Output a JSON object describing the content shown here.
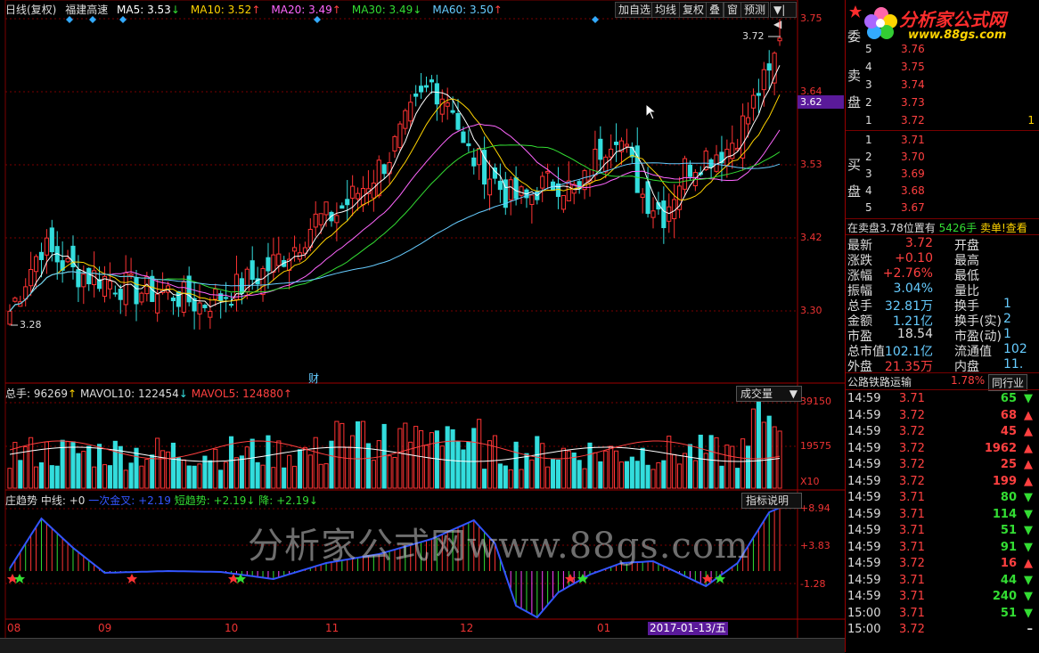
{
  "toolbar": {
    "period": "日线(复权)",
    "stock_name": "福建高速",
    "ma": [
      {
        "label": "MA5: 3.53",
        "arrow": "↓",
        "color": "#ffffff"
      },
      {
        "label": "MA10: 3.52",
        "arrow": "↑",
        "color": "#ffd400"
      },
      {
        "label": "MA20: 3.49",
        "arrow": "↑",
        "color": "#ff66ff"
      },
      {
        "label": "MA30: 3.49",
        "arrow": "↓",
        "color": "#33dd33"
      },
      {
        "label": "MA60: 3.50",
        "arrow": "↑",
        "color": "#66ccff"
      }
    ],
    "buttons": [
      "加自选",
      "均线",
      "复权",
      "叠",
      "窗",
      "预测"
    ],
    "more": "▼|◀"
  },
  "price_axis": [
    "3.75",
    "3.64",
    "3.53",
    "3.42",
    "3.30"
  ],
  "current_price": "3.62",
  "annot_high": "3.72",
  "annot_low": "3.28",
  "fin_mark": "财",
  "volume_panel": {
    "label_total": "总手: 96269",
    "label_total_arrow": "↑",
    "label_mavol10": "MAVOL10: 122454",
    "label_mavol10_arrow": "↓",
    "label_mavol5": "MAVOL5: 124880",
    "label_mavol5_arrow": "↑",
    "dropdown": "成交量",
    "axis": [
      "39150",
      "19575",
      "X10"
    ]
  },
  "indicator_panel": {
    "name": "庄趋势",
    "mid": "中线: +0",
    "once": "一次金叉: +2.19",
    "short": "短趋势: +2.19",
    "down": "降: +2.19",
    "button": "指标说明",
    "axis": [
      "+8.94",
      "+3.83",
      "-1.28"
    ]
  },
  "x_axis": [
    {
      "label": "08"
    },
    {
      "label": "09"
    },
    {
      "label": "10"
    },
    {
      "label": "11"
    },
    {
      "label": "12"
    },
    {
      "label": "01"
    }
  ],
  "cursor_date": "2017-01-13/五",
  "watermark": "分析家公式网www.88gs.com",
  "right": {
    "logo_text": "分析家公式网",
    "logo_url": "www.88gs.com",
    "committee": "委",
    "sell_chars": "卖盘",
    "buy_chars": "买盘",
    "sell": [
      {
        "lvl": "5",
        "price": "3.76",
        "vol": ""
      },
      {
        "lvl": "4",
        "price": "3.75",
        "vol": ""
      },
      {
        "lvl": "3",
        "price": "3.74",
        "vol": ""
      },
      {
        "lvl": "2",
        "price": "3.73",
        "vol": ""
      },
      {
        "lvl": "1",
        "price": "3.72",
        "vol": "1"
      }
    ],
    "buy": [
      {
        "lvl": "1",
        "price": "3.71",
        "vol": ""
      },
      {
        "lvl": "2",
        "price": "3.70",
        "vol": ""
      },
      {
        "lvl": "3",
        "price": "3.69",
        "vol": ""
      },
      {
        "lvl": "4",
        "price": "3.68",
        "vol": ""
      },
      {
        "lvl": "5",
        "price": "3.67",
        "vol": ""
      }
    ],
    "notice_left": "在卖盘3.78位置有",
    "notice_mid": "5426手",
    "notice_right": "卖单!查看",
    "stats": [
      {
        "l": "最新",
        "v": "3.72",
        "vc": "#ff4040",
        "l2": "开盘",
        "v2": ""
      },
      {
        "l": "涨跌",
        "v": "+0.10",
        "vc": "#ff4040",
        "l2": "最高",
        "v2": ""
      },
      {
        "l": "涨幅",
        "v": "+2.76%",
        "vc": "#ff4040",
        "l2": "最低",
        "v2": ""
      },
      {
        "l": "振幅",
        "v": "3.04%",
        "vc": "#66ccff",
        "l2": "量比",
        "v2": ""
      },
      {
        "l": "总手",
        "v": "32.81万",
        "vc": "#66ccff",
        "l2": "换手",
        "v2": "1"
      },
      {
        "l": "金额",
        "v": "1.21亿",
        "vc": "#66ccff",
        "l2": "换手(实)",
        "v2": "2"
      },
      {
        "l": "市盈",
        "v": "18.54",
        "vc": "#dddddd",
        "l2": "市盈(动)",
        "v2": "1"
      },
      {
        "l": "总市值",
        "v": "102.1亿",
        "vc": "#66ccff",
        "l2": "流通值",
        "v2": "102"
      },
      {
        "l": "外盘",
        "v": "21.35万",
        "vc": "#ff4040",
        "l2": "内盘",
        "v2": "11."
      }
    ],
    "industry": "公路铁路运输",
    "industry_pct": "1.78%",
    "industry_btn": "同行业",
    "ticks": [
      {
        "t": "14:59",
        "p": "3.71",
        "v": "65",
        "d": "down"
      },
      {
        "t": "14:59",
        "p": "3.72",
        "v": "68",
        "d": "up"
      },
      {
        "t": "14:59",
        "p": "3.72",
        "v": "45",
        "d": "up"
      },
      {
        "t": "14:59",
        "p": "3.72",
        "v": "1962",
        "d": "up"
      },
      {
        "t": "14:59",
        "p": "3.72",
        "v": "25",
        "d": "up"
      },
      {
        "t": "14:59",
        "p": "3.72",
        "v": "199",
        "d": "up"
      },
      {
        "t": "14:59",
        "p": "3.71",
        "v": "80",
        "d": "down"
      },
      {
        "t": "14:59",
        "p": "3.71",
        "v": "114",
        "d": "down"
      },
      {
        "t": "14:59",
        "p": "3.71",
        "v": "51",
        "d": "down"
      },
      {
        "t": "14:59",
        "p": "3.71",
        "v": "91",
        "d": "down"
      },
      {
        "t": "14:59",
        "p": "3.72",
        "v": "16",
        "d": "up"
      },
      {
        "t": "14:59",
        "p": "3.71",
        "v": "44",
        "d": "down"
      },
      {
        "t": "14:59",
        "p": "3.71",
        "v": "240",
        "d": "down"
      },
      {
        "t": "15:00",
        "p": "3.71",
        "v": "51",
        "d": "down"
      },
      {
        "t": "15:00",
        "p": "3.72",
        "v": "",
        "d": "none"
      }
    ]
  },
  "colors": {
    "up": "#ff3333",
    "down": "#33dddd",
    "grid": "#7a0000",
    "accent": "#5a1a9a"
  }
}
